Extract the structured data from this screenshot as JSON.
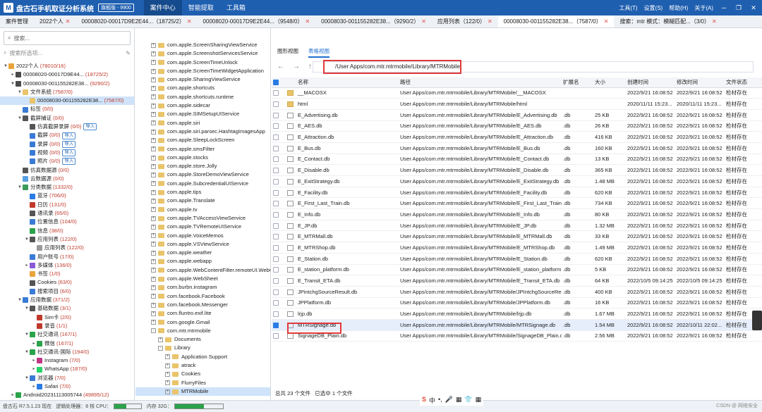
{
  "app": {
    "title": "盘古石手机取证分析系统",
    "version": "旗舰版 - 9900",
    "logo": "M",
    "menu": [
      "案件中心",
      "智能提取",
      "工具箱"
    ],
    "right_menu": [
      "工具(T)",
      "设置(S)",
      "帮助(H)",
      "关于(A)"
    ]
  },
  "tabs2": [
    {
      "label": "案件管理",
      "close": false
    },
    {
      "label": "2022个人",
      "close": true
    },
    {
      "label": "00008020-00017D9E2E44...（18725/2）",
      "close": true
    },
    {
      "label": "00008020-00017D9E2E44...（9548/0）",
      "close": true
    },
    {
      "label": "00008030-001155282E38...（9290/2）",
      "close": true
    },
    {
      "label": "应用列表（122/0）",
      "close": true
    },
    {
      "label": "00008030-001155282E38...（7587/0）",
      "close": true
    },
    {
      "label": "搜索：mtr 模式：模糊匹配...（3/0）",
      "close": true
    }
  ],
  "left": {
    "search_placeholder": "搜索...",
    "sub_placeholder": "搜索所选项..."
  },
  "tree": [
    {
      "d": 0,
      "t": "▼",
      "c": "#e9a33a",
      "l": "2022个人",
      "n": "(78010/16)",
      "s": ""
    },
    {
      "d": 1,
      "t": "▸",
      "c": "#4a4a4a",
      "l": "00008020-00017D9E44...",
      "n": "(18725/2)",
      "s": ""
    },
    {
      "d": 1,
      "t": "▼",
      "c": "#4a4a4a",
      "l": "00008030-001155282E38...",
      "n": "(9290/2)",
      "s": ""
    },
    {
      "d": 2,
      "t": "▼",
      "c": "#e9c46a",
      "l": "文件系统",
      "n": "(7587/0)",
      "s": ""
    },
    {
      "d": 3,
      "t": "",
      "c": "#e9c46a",
      "l": "00008030-001155282E38...",
      "n": "(7587/0)",
      "s": "sel"
    },
    {
      "d": 2,
      "t": "",
      "c": "#3a7bd5",
      "l": "标签",
      "n": "(0/0)",
      "s": ""
    },
    {
      "d": 2,
      "t": "▼",
      "c": "#555",
      "l": "截屏捕证",
      "n": "(0/0)",
      "s": ""
    },
    {
      "d": 3,
      "t": "",
      "c": "#555",
      "l": "仿真截屏录屏",
      "n": "(0/0)",
      "s": "imp"
    },
    {
      "d": 3,
      "t": "",
      "c": "#3a7bd5",
      "l": "截屏",
      "n": "(0/0)",
      "s": "imp"
    },
    {
      "d": 3,
      "t": "",
      "c": "#3a7bd5",
      "l": "录屏",
      "n": "(0/0)",
      "s": "imp"
    },
    {
      "d": 3,
      "t": "",
      "c": "#3a7bd5",
      "l": "视频",
      "n": "(0/0)",
      "s": "imp"
    },
    {
      "d": 3,
      "t": "",
      "c": "#3a7bd5",
      "l": "照片",
      "n": "(0/0)",
      "s": "imp"
    },
    {
      "d": 2,
      "t": "",
      "c": "#555",
      "l": "仿真数据源",
      "n": "(0/0)",
      "s": ""
    },
    {
      "d": 2,
      "t": "",
      "c": "#5aa0e0",
      "l": "云数据源",
      "n": "(0/0)",
      "s": ""
    },
    {
      "d": 2,
      "t": "▼",
      "c": "#3a9a5a",
      "l": "分类数据",
      "n": "(1332/0)",
      "s": ""
    },
    {
      "d": 3,
      "t": "",
      "c": "#2a7be4",
      "l": "蓝牙",
      "n": "(706/0)",
      "s": ""
    },
    {
      "d": 3,
      "t": "",
      "c": "#c0392b",
      "l": "日历",
      "n": "(131/0)",
      "s": ""
    },
    {
      "d": 3,
      "t": "",
      "c": "#555",
      "l": "通讯录",
      "n": "(65/0)",
      "s": ""
    },
    {
      "d": 3,
      "t": "",
      "c": "#3a7bd5",
      "l": "位置信息",
      "n": "(104/0)",
      "s": ""
    },
    {
      "d": 3,
      "t": "",
      "c": "#2aa34a",
      "l": "信息",
      "n": "(38/0)",
      "s": ""
    },
    {
      "d": 3,
      "t": "▼",
      "c": "#555",
      "l": "应用列表",
      "n": "(122/0)",
      "s": ""
    },
    {
      "d": 4,
      "t": "",
      "c": "#999",
      "l": "应用列表",
      "n": "(122/0)",
      "s": ""
    },
    {
      "d": 3,
      "t": "",
      "c": "#3a7bd5",
      "l": "用户账号",
      "n": "(17/0)",
      "s": ""
    },
    {
      "d": 3,
      "t": "▸",
      "c": "#8a5ad5",
      "l": "多媒体",
      "n": "(136/0)",
      "s": ""
    },
    {
      "d": 3,
      "t": "",
      "c": "#e9a33a",
      "l": "书签",
      "n": "(1/0)",
      "s": ""
    },
    {
      "d": 3,
      "t": "",
      "c": "#555",
      "l": "Cookies",
      "n": "(63/0)",
      "s": ""
    },
    {
      "d": 3,
      "t": "",
      "c": "#3a7bd5",
      "l": "搜索项目",
      "n": "(6/0)",
      "s": ""
    },
    {
      "d": 2,
      "t": "▼",
      "c": "#3a7bd5",
      "l": "应用数据",
      "n": "(371/2)",
      "s": ""
    },
    {
      "d": 3,
      "t": "▼",
      "c": "#555",
      "l": "基础数据",
      "n": "(3/1)",
      "s": ""
    },
    {
      "d": 4,
      "t": "",
      "c": "#c0392b",
      "l": "Sim卡",
      "n": "(2/0)",
      "s": ""
    },
    {
      "d": 4,
      "t": "",
      "c": "#c0392b",
      "l": "录音",
      "n": "(1/1)",
      "s": ""
    },
    {
      "d": 3,
      "t": "▼",
      "c": "#2aa34a",
      "l": "社交通讯",
      "n": "(167/1)",
      "s": ""
    },
    {
      "d": 4,
      "t": "▸",
      "c": "#2aa34a",
      "l": "微信",
      "n": "(167/1)",
      "s": ""
    },
    {
      "d": 3,
      "t": "▼",
      "c": "#2aa34a",
      "l": "社交通讯-国际",
      "n": "(194/0)",
      "s": ""
    },
    {
      "d": 4,
      "t": "▸",
      "c": "#c13584",
      "l": "Instagram",
      "n": "(7/0)",
      "s": ""
    },
    {
      "d": 4,
      "t": "▸",
      "c": "#25d366",
      "l": "WhatsApp",
      "n": "(187/0)",
      "s": ""
    },
    {
      "d": 3,
      "t": "▼",
      "c": "#3a7bd5",
      "l": "浏览器",
      "n": "(7/0)",
      "s": ""
    },
    {
      "d": 4,
      "t": "▸",
      "c": "#2a7be4",
      "l": "Safari",
      "n": "(7/0)",
      "s": ""
    },
    {
      "d": 1,
      "t": "▸",
      "c": "#2aa34a",
      "l": "Android20231113005744",
      "n": "(49895/12)",
      "s": ""
    }
  ],
  "import_label": "导入",
  "mid": {
    "tabs": [
      "图形视图",
      "表格视图"
    ]
  },
  "ftree": [
    {
      "d": 0,
      "l": "com.apple.ScreenSharingViewService",
      "e": "+"
    },
    {
      "d": 0,
      "l": "com.apple.ScreenshotServicesService",
      "e": "+"
    },
    {
      "d": 0,
      "l": "com.apple.ScreenTimeUnlock",
      "e": "+"
    },
    {
      "d": 0,
      "l": "com.apple.ScreenTimeWidgetApplication",
      "e": "+"
    },
    {
      "d": 0,
      "l": "com.apple.SharingViewService",
      "e": "+"
    },
    {
      "d": 0,
      "l": "com.apple.shortcuts",
      "e": "+"
    },
    {
      "d": 0,
      "l": "com.apple.shortcuts.runtime",
      "e": "+"
    },
    {
      "d": 0,
      "l": "com.apple.sidecar",
      "e": "+"
    },
    {
      "d": 0,
      "l": "com.apple.SIMSetupUIService",
      "e": "+"
    },
    {
      "d": 0,
      "l": "com.apple.siri",
      "e": "+"
    },
    {
      "d": 0,
      "l": "com.apple.siri.parsec.HashtagImagesApp",
      "e": "+"
    },
    {
      "d": 0,
      "l": "com.apple.SleepLockScreen",
      "e": "+"
    },
    {
      "d": 0,
      "l": "com.apple.smsFilter",
      "e": "+"
    },
    {
      "d": 0,
      "l": "com.apple.stocks",
      "e": "+"
    },
    {
      "d": 0,
      "l": "com.apple.store.Jolly",
      "e": "+"
    },
    {
      "d": 0,
      "l": "com.apple.StoreDemoViewService",
      "e": "+"
    },
    {
      "d": 0,
      "l": "com.apple.SubcredentialUIService",
      "e": "+"
    },
    {
      "d": 0,
      "l": "com.apple.tips",
      "e": "+"
    },
    {
      "d": 0,
      "l": "com.apple.Translate",
      "e": "+"
    },
    {
      "d": 0,
      "l": "com.apple.tv",
      "e": "+"
    },
    {
      "d": 0,
      "l": "com.apple.TVAccessViewService",
      "e": "+"
    },
    {
      "d": 0,
      "l": "com.apple.TVRemoteUIService",
      "e": "+"
    },
    {
      "d": 0,
      "l": "com.apple.VoiceMemos",
      "e": "+"
    },
    {
      "d": 0,
      "l": "com.apple.VSViewService",
      "e": "+"
    },
    {
      "d": 0,
      "l": "com.apple.weather",
      "e": "+"
    },
    {
      "d": 0,
      "l": "com.apple.webapp",
      "e": "+"
    },
    {
      "d": 0,
      "l": "com.apple.WebContentFilter.remoteUI.WebC",
      "e": "+"
    },
    {
      "d": 0,
      "l": "com.apple.WebSheet",
      "e": "+"
    },
    {
      "d": 0,
      "l": "com.burbn.instagram",
      "e": "+"
    },
    {
      "d": 0,
      "l": "com.facebook.Facebook",
      "e": "+"
    },
    {
      "d": 0,
      "l": "com.facebook.Messenger",
      "e": "+"
    },
    {
      "d": 0,
      "l": "com.fluntro.exif.lite",
      "e": "+"
    },
    {
      "d": 0,
      "l": "com.google.Gmail",
      "e": "+"
    },
    {
      "d": 0,
      "l": "com.mtr.mtrmobile",
      "e": "-"
    },
    {
      "d": 1,
      "l": "Documents",
      "e": "+"
    },
    {
      "d": 1,
      "l": "Library",
      "e": "-"
    },
    {
      "d": 2,
      "l": "Application Support",
      "e": "+"
    },
    {
      "d": 2,
      "l": "atrack",
      "e": "+"
    },
    {
      "d": 2,
      "l": "Cookies",
      "e": "+"
    },
    {
      "d": 2,
      "l": "FlurryFiles",
      "e": "+"
    },
    {
      "d": 2,
      "l": "MTRMobile",
      "e": "+",
      "sel": true
    }
  ],
  "path": "/User Apps/com.mtr.mtrmobile/Library/MTRMobile",
  "table": {
    "headers": [
      "名称",
      "路径",
      "扩展名",
      "大小",
      "创建时间",
      "修改时间",
      "文件状态"
    ],
    "rows": [
      [
        "__MACOSX",
        "User Apps/com.mtr.mtrmobile/Library/MTRMobile/__MACOSX",
        "",
        "",
        "2022/9/21 16:08:52",
        "2022/9/21 16:08:52",
        "检材存在",
        "f",
        ""
      ],
      [
        "html",
        "User Apps/com.mtr.mtrmobile/Library/MTRMobile/html",
        "",
        "",
        "2020/11/11 15:23...",
        "2020/11/11 15:23...",
        "检材存在",
        "f",
        ""
      ],
      [
        "E_Advertising.db",
        "User Apps/com.mtr.mtrmobile/Library/MTRMobile/E_Advertising.db",
        ".db",
        "25 KB",
        "2022/9/21 16:08:52",
        "2022/9/21 16:08:52",
        "检材存在",
        "",
        ""
      ],
      [
        "E_AES.db",
        "User Apps/com.mtr.mtrmobile/Library/MTRMobile/E_AES.db",
        ".db",
        "26 KB",
        "2022/9/21 16:08:52",
        "2022/9/21 16:08:52",
        "检材存在",
        "",
        ""
      ],
      [
        "E_Attraction.db",
        "User Apps/com.mtr.mtrmobile/Library/MTRMobile/E_Attraction.db",
        ".db",
        "416 KB",
        "2022/9/21 16:08:52",
        "2022/9/21 16:08:52",
        "检材存在",
        "",
        ""
      ],
      [
        "E_Bus.db",
        "User Apps/com.mtr.mtrmobile/Library/MTRMobile/E_Bus.db",
        ".db",
        "160 KB",
        "2022/9/21 16:08:52",
        "2022/9/21 16:08:52",
        "检材存在",
        "",
        ""
      ],
      [
        "E_Contact.db",
        "User Apps/com.mtr.mtrmobile/Library/MTRMobile/E_Contact.db",
        ".db",
        "13 KB",
        "2022/9/21 16:08:52",
        "2022/9/21 16:08:52",
        "检材存在",
        "",
        ""
      ],
      [
        "E_Disable.db",
        "User Apps/com.mtr.mtrmobile/Library/MTRMobile/E_Disable.db",
        ".db",
        "365 KB",
        "2022/9/21 16:08:52",
        "2022/9/21 16:08:52",
        "检材存在",
        "",
        ""
      ],
      [
        "E_ExitStrategy.db",
        "User Apps/com.mtr.mtrmobile/Library/MTRMobile/E_ExitStrategy.db",
        ".db",
        "1.48 MB",
        "2022/9/21 16:08:52",
        "2022/9/21 16:08:52",
        "检材存在",
        "",
        ""
      ],
      [
        "E_Facility.db",
        "User Apps/com.mtr.mtrmobile/Library/MTRMobile/E_Facility.db",
        ".db",
        "620 KB",
        "2022/9/21 16:08:52",
        "2022/9/21 16:08:52",
        "检材存在",
        "",
        ""
      ],
      [
        "E_First_Last_Train.db",
        "User Apps/com.mtr.mtrmobile/Library/MTRMobile/E_First_Last_Train.d",
        ".db",
        "734 KB",
        "2022/9/21 16:08:52",
        "2022/9/21 16:08:52",
        "检材存在",
        "",
        ""
      ],
      [
        "E_Info.db",
        "User Apps/com.mtr.mtrmobile/Library/MTRMobile/E_Info.db",
        ".db",
        "80 KB",
        "2022/9/21 16:08:52",
        "2022/9/21 16:08:52",
        "检材存在",
        "",
        ""
      ],
      [
        "E_JP.db",
        "User Apps/com.mtr.mtrmobile/Library/MTRMobile/E_JP.db",
        ".db",
        "1.32 MB",
        "2022/9/21 16:08:52",
        "2022/9/21 16:08:52",
        "检材存在",
        "",
        ""
      ],
      [
        "E_MTRMall.db",
        "User Apps/com.mtr.mtrmobile/Library/MTRMobile/E_MTRMall.db",
        ".db",
        "33 KB",
        "2022/9/21 16:08:52",
        "2022/9/21 16:08:52",
        "检材存在",
        "",
        ""
      ],
      [
        "E_MTRShop.db",
        "User Apps/com.mtr.mtrmobile/Library/MTRMobile/E_MTRShop.db",
        ".db",
        "1.49 MB",
        "2022/9/21 16:08:52",
        "2022/9/21 16:08:52",
        "检材存在",
        "",
        ""
      ],
      [
        "E_Station.db",
        "User Apps/com.mtr.mtrmobile/Library/MTRMobile/E_Station.db",
        ".db",
        "620 KB",
        "2022/9/21 16:08:52",
        "2022/9/21 16:08:52",
        "检材存在",
        "",
        ""
      ],
      [
        "E_station_platform.db",
        "User Apps/com.mtr.mtrmobile/Library/MTRMobile/E_station_platform",
        ".db",
        "5 KB",
        "2022/9/21 16:08:52",
        "2022/9/21 16:08:52",
        "检材存在",
        "",
        ""
      ],
      [
        "E_Transit_ETA.db",
        "User Apps/com.mtr.mtrmobile/Library/MTRMobile/E_Transit_ETA.db",
        ".db",
        "64 KB",
        "2022/10/5 09:14:25",
        "2022/10/5 09:14:25",
        "检材存在",
        "",
        ""
      ],
      [
        "JPintchgSourceResult.db",
        "User Apps/com.mtr.mtrmobile/Library/MTRMobile/JPIntchgSourceRes",
        ".db",
        "400 KB",
        "2022/9/21 16:08:52",
        "2022/9/21 16:08:52",
        "检材存在",
        "",
        ""
      ],
      [
        "JPPlatform.db",
        "User Apps/com.mtr.mtrmobile/Library/MTRMobile/JPPlatform.db",
        ".db",
        "16 KB",
        "2022/9/21 16:08:52",
        "2022/9/21 16:08:52",
        "检材存在",
        "",
        ""
      ],
      [
        "lrjp.db",
        "User Apps/com.mtr.mtrmobile/Library/MTRMobile/lrjp.db",
        ".db",
        "1.67 MB",
        "2022/9/21 16:08:52",
        "2022/9/21 16:08:52",
        "检材存在",
        "",
        ""
      ],
      [
        "MTRSignage.db",
        "User Apps/com.mtr.mtrmobile/Library/MTRMobile/MTRSignage.db",
        ".db",
        "1.54 MB",
        "2022/9/21 16:08:52",
        "2022/10/11 22:02...",
        "检材存在",
        "",
        "hl"
      ],
      [
        "SignageDB_Plain.db",
        "User Apps/com.mtr.mtrmobile/Library/MTRMobile/SignageDB_Plain.d",
        ".db",
        "2.56 MB",
        "2022/9/21 16:08:52",
        "2022/9/21 16:08:52",
        "检材存在",
        "",
        ""
      ]
    ]
  },
  "footer": {
    "total": "总共 23 个文件",
    "selected": "已选中 1 个文件"
  },
  "status": {
    "left": "盘古石 R7.5.1.23 现在",
    "cpu_text": "逻辑处理器：8 核 CPU：",
    "mem_text": "内存 32G：",
    "cpu": 0.45,
    "mem": 0.6
  },
  "watermark": "CSDN @ 网络安全",
  "ime": [
    "S",
    "中",
    "•,",
    "🎤",
    "▦",
    "👕",
    "▦"
  ]
}
